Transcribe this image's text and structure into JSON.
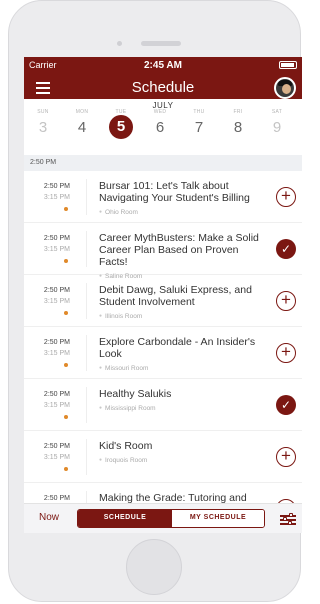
{
  "status": {
    "carrier": "Carrier",
    "time": "2:45 AM"
  },
  "header": {
    "title": "Schedule"
  },
  "calendar": {
    "month": "JULY",
    "days": [
      {
        "dow": "SUN",
        "num": "3"
      },
      {
        "dow": "MON",
        "num": "4"
      },
      {
        "dow": "TUE",
        "num": "5"
      },
      {
        "dow": "WED",
        "num": "6"
      },
      {
        "dow": "THU",
        "num": "7"
      },
      {
        "dow": "FRI",
        "num": "8"
      },
      {
        "dow": "SAT",
        "num": "9"
      }
    ],
    "selected": "5"
  },
  "section": {
    "label": "2:50 PM"
  },
  "sessions": [
    {
      "start": "2:50 PM",
      "end": "3:15 PM",
      "title": "Bursar 101:  Let's Talk about Navigating Your Student's Billing",
      "location": "Ohio Room",
      "action": "add",
      "icon_add": "+",
      "icon_done": "✓"
    },
    {
      "start": "2:50 PM",
      "end": "3:15 PM",
      "title": "Career MythBusters: Make a Solid Career Plan Based on Proven Facts!",
      "location": "Saline Room",
      "action": "done",
      "icon_add": "+",
      "icon_done": "✓"
    },
    {
      "start": "2:50 PM",
      "end": "3:15 PM",
      "title": "Debit Dawg, Saluki Express, and Student Involvement",
      "location": "Illinois Room",
      "action": "add",
      "icon_add": "+",
      "icon_done": "✓"
    },
    {
      "start": "2:50 PM",
      "end": "3:15 PM",
      "title": "Explore Carbondale - An Insider's Look",
      "location": "Missouri Room",
      "action": "add",
      "icon_add": "+",
      "icon_done": "✓"
    },
    {
      "start": "2:50 PM",
      "end": "3:15 PM",
      "title": "Healthy Salukis",
      "location": "Mississippi Room",
      "action": "done",
      "icon_add": "+",
      "icon_done": "✓"
    },
    {
      "start": "2:50 PM",
      "end": "3:15 PM",
      "title": "Kid's Room",
      "location": "Iroquois Room",
      "action": "add",
      "icon_add": "+",
      "icon_done": "✓"
    },
    {
      "start": "2:50 PM",
      "end": "",
      "title": "Making the Grade: Tutoring and",
      "location": "",
      "action": "add",
      "icon_add": "+",
      "icon_done": "✓"
    }
  ],
  "bottom": {
    "now_label": "Now",
    "tab_schedule": "SCHEDULE",
    "tab_my_schedule": "MY SCHEDULE"
  },
  "colors": {
    "accent": "#7b1712",
    "dot": "#e0892a"
  }
}
